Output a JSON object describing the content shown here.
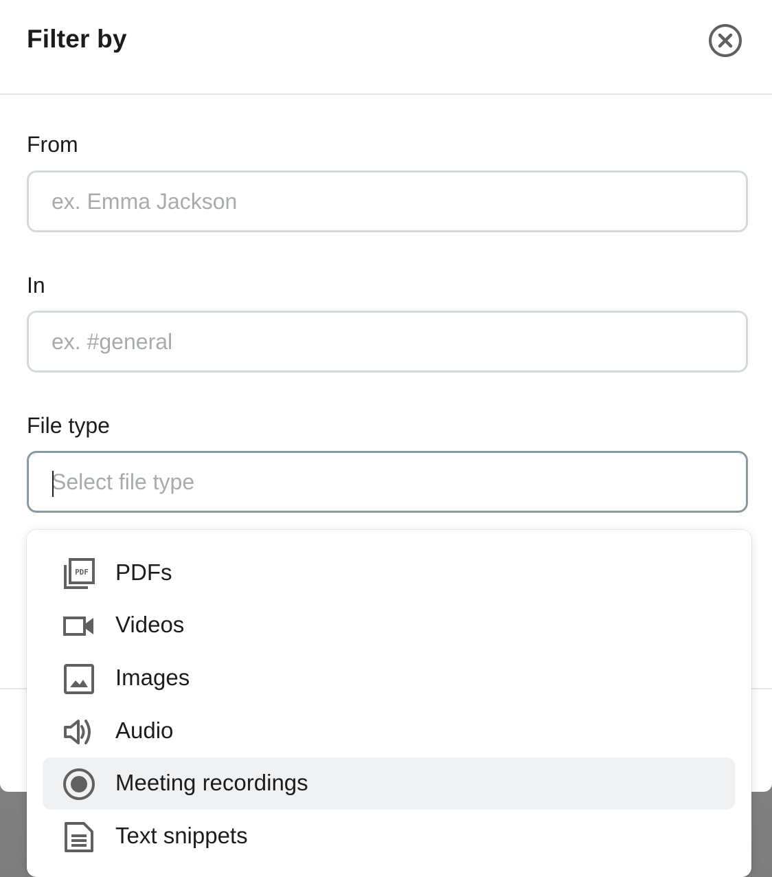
{
  "modal": {
    "title": "Filter by"
  },
  "fields": {
    "from": {
      "label": "From",
      "placeholder": "ex. Emma Jackson",
      "value": ""
    },
    "in": {
      "label": "In",
      "placeholder": "ex. #general",
      "value": ""
    },
    "file_type": {
      "label": "File type",
      "placeholder": "Select file type",
      "value": ""
    }
  },
  "file_type_options": [
    {
      "label": "PDFs",
      "icon": "pdf-icon"
    },
    {
      "label": "Videos",
      "icon": "video-camera-icon"
    },
    {
      "label": "Images",
      "icon": "image-icon"
    },
    {
      "label": "Audio",
      "icon": "speaker-icon"
    },
    {
      "label": "Meeting recordings",
      "icon": "record-icon",
      "highlighted": true
    },
    {
      "label": "Text snippets",
      "icon": "document-icon"
    }
  ],
  "colors": {
    "text": "#1d1c1d",
    "placeholder": "#a7abae",
    "icon": "#616061",
    "highlight": "#eff1f2",
    "focused_border": "#8a989f"
  }
}
